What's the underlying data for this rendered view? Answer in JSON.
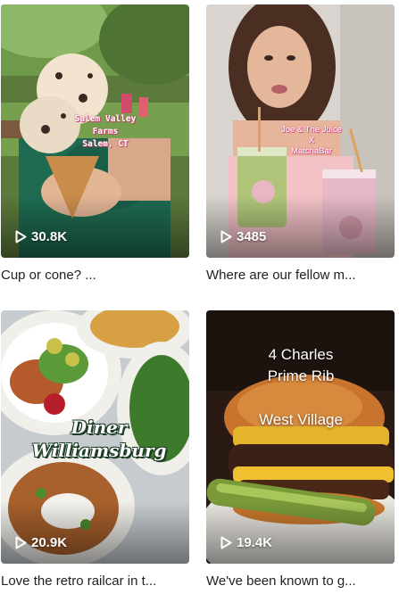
{
  "videos": [
    {
      "views": "30.8K",
      "caption": "Cup or cone? ...",
      "overlay": [
        "Salem Valley",
        "Farms",
        "Salem, CT"
      ]
    },
    {
      "views": "3485",
      "caption": "Where are our fellow m...",
      "overlay": [
        "Joe & The Juice",
        "X",
        "MatchaBar"
      ]
    },
    {
      "views": "20.9K",
      "caption": "Love the retro railcar in t...",
      "overlay": [
        "Diner",
        "Williamsburg"
      ]
    },
    {
      "views": "19.4K",
      "caption": "We've been known to g...",
      "overlay": [
        "4 Charles",
        "Prime Rib",
        "West Village"
      ]
    }
  ],
  "icons": {
    "views": "play-icon"
  },
  "colors": {
    "caption_text": "#222222",
    "view_text": "#ffffff"
  }
}
